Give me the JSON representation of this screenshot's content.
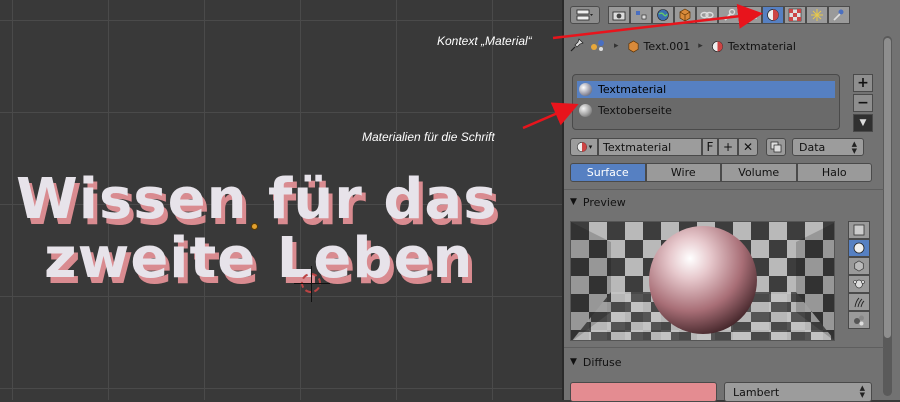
{
  "viewport": {
    "scene_text_line1": "Wissen für das",
    "scene_text_line2": "zweite Leben"
  },
  "annotations": {
    "context_label": "Kontext „Material“",
    "materials_label": "Materialien für die Schrift"
  },
  "panel": {
    "breadcrumb": {
      "object": "Text.001",
      "material": "Textmaterial"
    },
    "material_slots": [
      {
        "label": "Textmaterial",
        "selected": true
      },
      {
        "label": "Textoberseite",
        "selected": false
      }
    ],
    "slot_buttons": {
      "add": "+",
      "remove": "−",
      "menu": "▼"
    },
    "material_field": {
      "name": "Textmaterial",
      "fake_user": "F",
      "add": "+",
      "unlink": "✕",
      "link_value": "Data"
    },
    "tabs": [
      {
        "label": "Surface",
        "active": true
      },
      {
        "label": "Wire",
        "active": false
      },
      {
        "label": "Volume",
        "active": false
      },
      {
        "label": "Halo",
        "active": false
      }
    ],
    "sections": {
      "preview": "Preview",
      "diffuse": "Diffuse"
    },
    "diffuse": {
      "color": "#e48c91",
      "shader": "Lambert"
    }
  },
  "colors": {
    "accent": "#5680c2",
    "text_face": "#e7e3ea",
    "text_extrude": "#d98b90",
    "annotation_arrow": "#e8141c"
  }
}
